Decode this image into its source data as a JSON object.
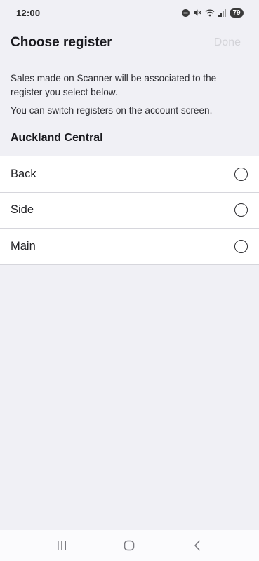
{
  "status_bar": {
    "time": "12:00",
    "battery": "79",
    "icons": [
      "do-not-disturb-icon",
      "mute-icon",
      "wifi-icon",
      "signal-icon",
      "battery-icon"
    ]
  },
  "header": {
    "title": "Choose register",
    "done_label": "Done"
  },
  "description": {
    "line1": "Sales made on Scanner will be associated to the register you select below.",
    "line2": "You can switch registers on the account screen."
  },
  "location": {
    "name": "Auckland Central"
  },
  "registers": [
    {
      "label": "Back",
      "selected": false
    },
    {
      "label": "Side",
      "selected": false
    },
    {
      "label": "Main",
      "selected": false
    }
  ],
  "nav_bar": {
    "buttons": [
      "recent-apps-icon",
      "home-icon",
      "back-icon"
    ]
  },
  "colors": {
    "background": "#f0f0f5",
    "list_background": "#ffffff",
    "done_disabled": "#d3d3d8",
    "divider": "#d6d6dc"
  }
}
